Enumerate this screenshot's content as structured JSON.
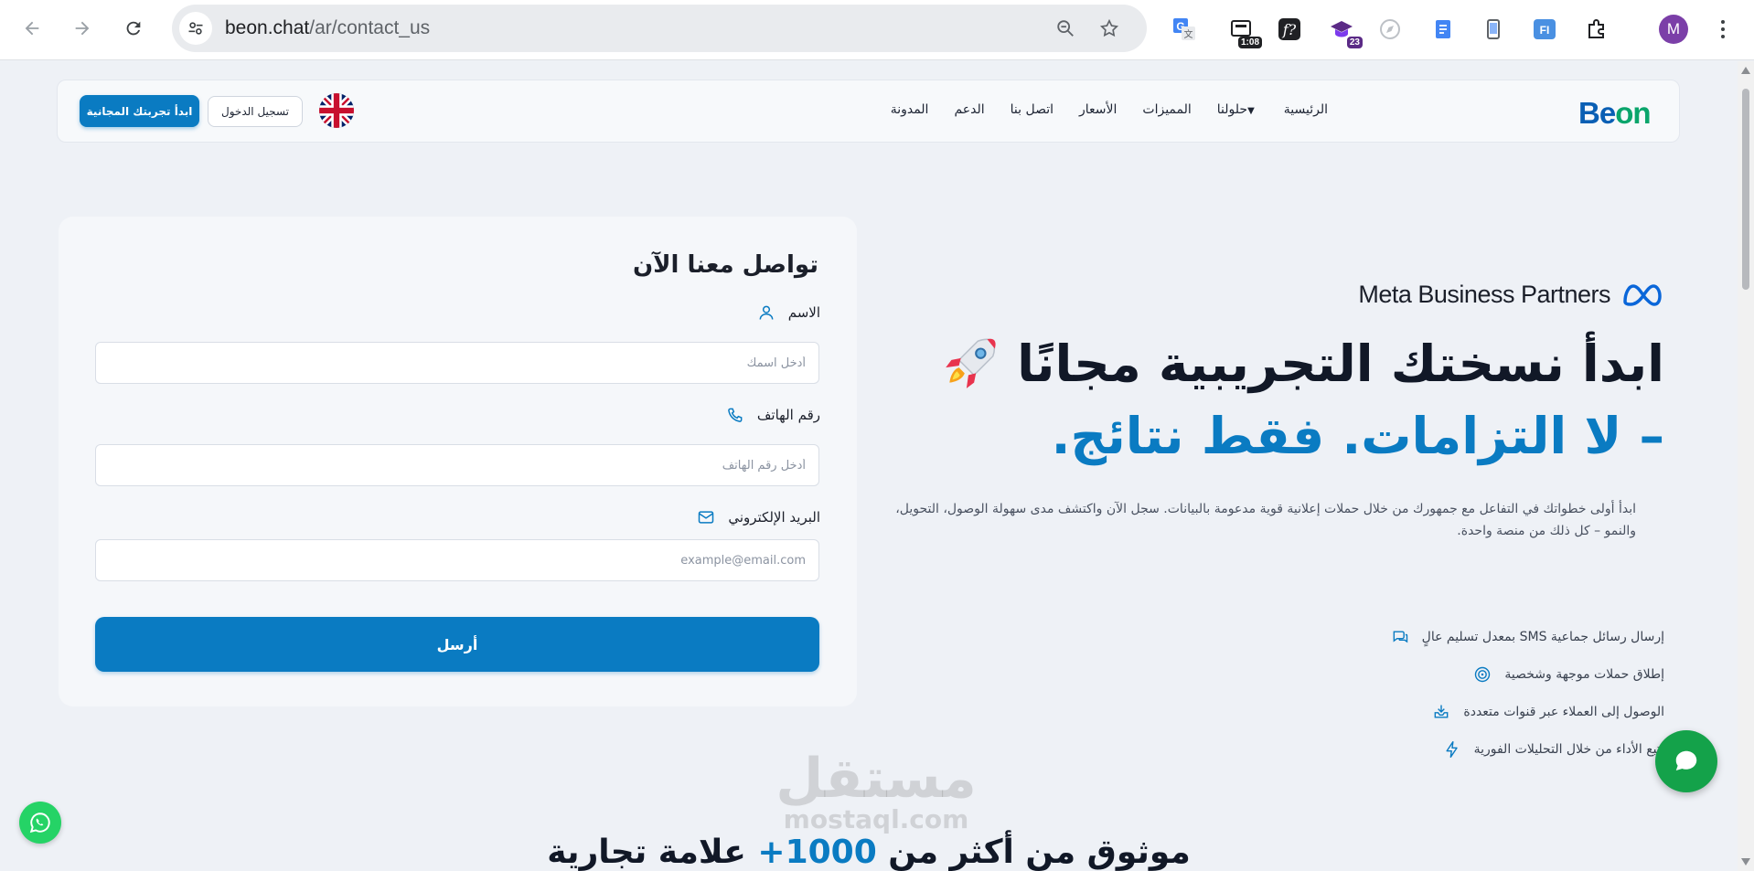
{
  "browser": {
    "url_host": "beon.chat",
    "url_path": "/ar/contact_us",
    "extension_timer_badge": "1:08",
    "extension_count_badge": "23",
    "profile_initial": "M"
  },
  "header": {
    "logo_b": "B",
    "logo_e": "e",
    "logo_on": "on",
    "menu": [
      {
        "label": "الرئيسية"
      },
      {
        "label": "حلولنا",
        "dropdown": true
      },
      {
        "label": "المميزات"
      },
      {
        "label": "الأسعار"
      },
      {
        "label": "اتصل بنا"
      },
      {
        "label": "الدعم"
      },
      {
        "label": "المدونة"
      }
    ],
    "login_label": "تسجيل الدخول",
    "trial_label": "ابدأ تجربتك المجانية"
  },
  "form": {
    "title": "تواصل معنا الآن",
    "name_label": "الاسم",
    "name_placeholder": "أدخل اسمك",
    "phone_label": "رقم الهاتف",
    "phone_placeholder": "أدخل رقم الهاتف",
    "email_label": "البريد الإلكتروني",
    "email_placeholder": "example@email.com",
    "submit_label": "أرسل"
  },
  "hero": {
    "partner_text": "Meta Business Partners",
    "title": "ابدأ نسختك التجريبية مجانًا",
    "subtitle": "– لا التزامات. فقط نتائج.",
    "description": "ابدأ أولى خطواتك في التفاعل مع جمهورك من خلال حملات إعلانية قوية مدعومة بالبيانات. سجل الآن واكتشف مدى سهولة الوصول، التحويل، والنمو – كل ذلك من منصة واحدة.",
    "features": [
      {
        "label": "إرسال رسائل جماعية SMS بمعدل تسليم عالٍ",
        "icon": "chat-bubbles-icon"
      },
      {
        "label": "إطلاق حملات موجهة وشخصية",
        "icon": "target-icon"
      },
      {
        "label": "الوصول إلى العملاء عبر قنوات متعددة",
        "icon": "inbox-download-icon"
      },
      {
        "label": "تتبع الأداء من خلال التحليلات الفورية",
        "icon": "lightning-icon"
      }
    ]
  },
  "watermark": {
    "arabic": "مستقل",
    "latin": "mostaql.com"
  },
  "trust": {
    "prefix": "موثوق من أكثر من ",
    "number": "1000+",
    "suffix": " علامة تجارية"
  },
  "colors": {
    "primary": "#0a7bc2",
    "whatsapp": "#25d366",
    "chat": "#14a24a"
  }
}
